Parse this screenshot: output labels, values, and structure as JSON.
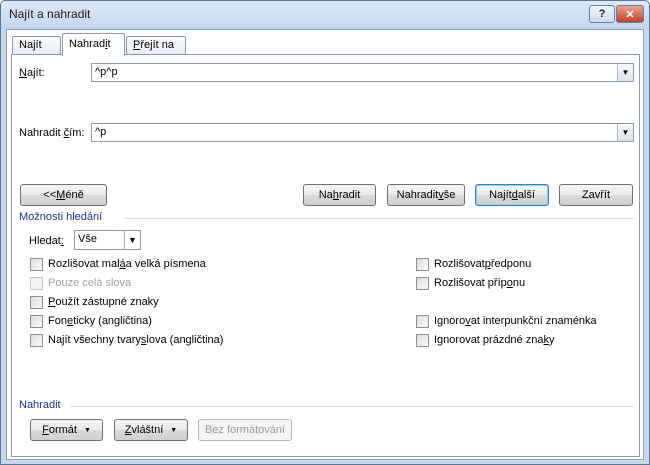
{
  "window": {
    "title": "Najít a nahradit",
    "help_label": "?",
    "close_label": "✕"
  },
  "tabs": {
    "najit": {
      "pre": "Na",
      "key": "j",
      "post": "ít"
    },
    "nahradit": {
      "pre": "Nahrad",
      "key": "i",
      "post": "t"
    },
    "prejit": {
      "pre": "",
      "key": "P",
      "post": "řejít na"
    }
  },
  "find": {
    "label_key": "N",
    "label_post": "ajít:",
    "value": "^p^p"
  },
  "replace": {
    "label_pre": "Nahradit ",
    "label_key": "č",
    "label_post": "ím:",
    "value": "^p"
  },
  "buttons": {
    "less": {
      "pre": "<< ",
      "key": "M",
      "post": "éně"
    },
    "replace": {
      "pre": "Na",
      "key": "h",
      "post": "radit"
    },
    "replace_all": {
      "pre": "Nahradit ",
      "key": "v",
      "post": "še"
    },
    "find_next": {
      "pre": "Najít ",
      "key": "d",
      "post": "alší"
    },
    "close": "Zavřít"
  },
  "options": {
    "title": "Možnosti hledání",
    "search_label_pre": "Hledat",
    "search_label_key": ":",
    "search_value": "Vše",
    "checkboxes": {
      "match_case": {
        "pre": "Rozlišovat mal",
        "key": "á",
        "post": " a velká písmena"
      },
      "whole_words": "Pouze celá slova",
      "wildcards": {
        "pre": "",
        "key": "P",
        "post": "oužít zástupné znaky"
      },
      "sounds_like": {
        "pre": "Fon",
        "key": "e",
        "post": "ticky (angličtina)"
      },
      "word_forms": {
        "pre": "Najít všechny tvary ",
        "key": "s",
        "post": "lova (angličtina)"
      },
      "match_prefix": {
        "pre": "Rozlišovat ",
        "key": "p",
        "post": "ředponu"
      },
      "match_suffix": {
        "pre": "Rozlišovat příp",
        "key": "o",
        "post": "nu"
      },
      "ignore_punct": {
        "pre": "Ignoro",
        "key": "v",
        "post": "at interpunkční znaménka"
      },
      "ignore_space": {
        "pre": "Ignorovat prázdné zna",
        "key": "k",
        "post": "y"
      }
    }
  },
  "replace_section": {
    "title": "Nahradit",
    "format": {
      "pre": "",
      "key": "F",
      "post": "ormát"
    },
    "special": {
      "pre": "",
      "key": "Z",
      "post": "vláštní"
    },
    "no_format": "Bez formátování"
  }
}
